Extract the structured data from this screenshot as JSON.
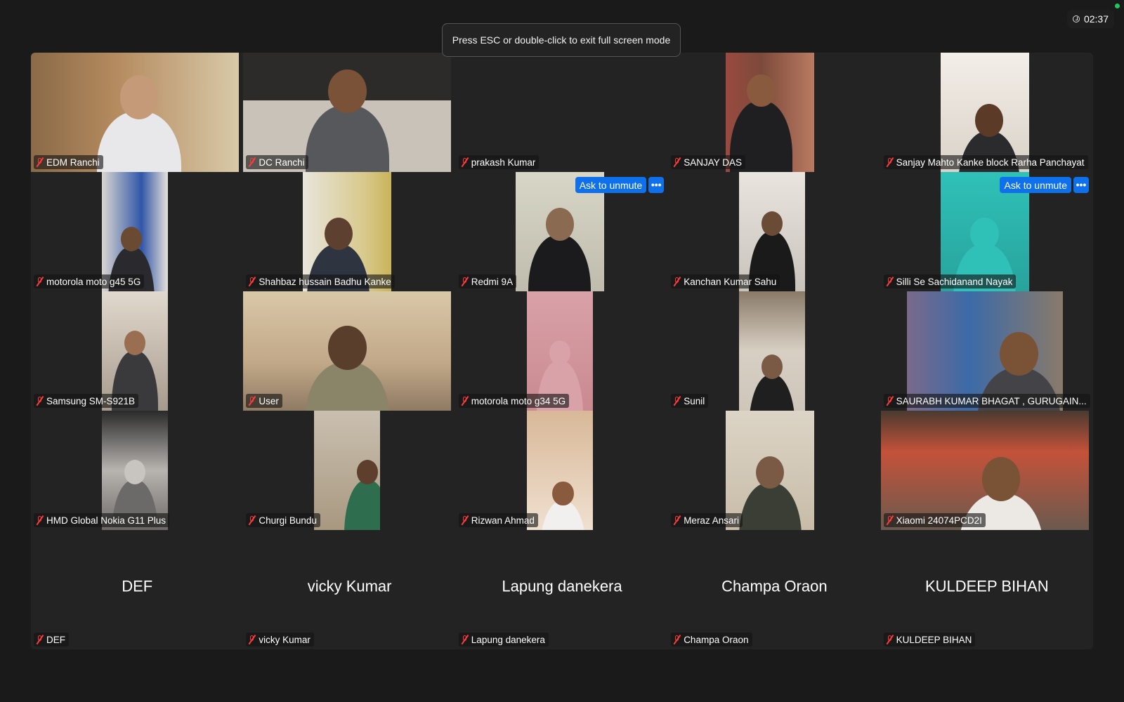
{
  "banner": {
    "text": "Press ESC or double-click to exit full screen mode"
  },
  "timer": {
    "icon": "clock-icon",
    "value": "02:37"
  },
  "actions": {
    "ask_to_unmute": "Ask to unmute",
    "more": "•••"
  },
  "participants": [
    {
      "name": "EDM Ranchi",
      "muted": true,
      "video": true
    },
    {
      "name": "DC Ranchi",
      "muted": true,
      "video": true
    },
    {
      "name": "prakash Kumar",
      "muted": true,
      "video": false
    },
    {
      "name": "SANJAY DAS",
      "muted": true,
      "video": true
    },
    {
      "name": "Sanjay Mahto Kanke block Rarha Panchayat",
      "muted": true,
      "video": true
    },
    {
      "name": "motorola moto g45 5G",
      "muted": true,
      "video": true
    },
    {
      "name": "Shahbaz hussain Badhu Kanke",
      "muted": true,
      "video": true
    },
    {
      "name": "Redmi 9A",
      "muted": true,
      "video": true,
      "hover_actions": true
    },
    {
      "name": "Kanchan Kumar Sahu",
      "muted": true,
      "video": true
    },
    {
      "name": "Silli Se Sachidanand Nayak",
      "muted": true,
      "video": true,
      "hover_actions": true
    },
    {
      "name": "Samsung SM-S921B",
      "muted": true,
      "video": true
    },
    {
      "name": "User",
      "muted": true,
      "video": true
    },
    {
      "name": "motorola moto g34 5G",
      "muted": true,
      "video": true
    },
    {
      "name": "Sunil",
      "muted": true,
      "video": true
    },
    {
      "name": "SAURABH KUMAR BHAGAT , GURUGAIN...",
      "muted": true,
      "video": true
    },
    {
      "name": "HMD Global Nokia G11 Plus",
      "muted": true,
      "video": true
    },
    {
      "name": "Churgi Bundu",
      "muted": true,
      "video": true
    },
    {
      "name": "Rizwan Ahmad",
      "muted": true,
      "video": true
    },
    {
      "name": "Meraz Ansari",
      "muted": true,
      "video": true
    },
    {
      "name": "Xiaomi 24074PCD2I",
      "muted": true,
      "video": true
    },
    {
      "name": "DEF",
      "muted": true,
      "video": false
    },
    {
      "name": "vicky Kumar",
      "muted": true,
      "video": false
    },
    {
      "name": "Lapung danekera",
      "muted": true,
      "video": false
    },
    {
      "name": "Champa Oraon",
      "muted": true,
      "video": false
    },
    {
      "name": "KULDEEP BIHAN",
      "muted": true,
      "video": false
    }
  ],
  "colors": {
    "accent": "#0e71eb",
    "muted_icon": "#ff3b3b",
    "background": "#1a1a1a"
  }
}
